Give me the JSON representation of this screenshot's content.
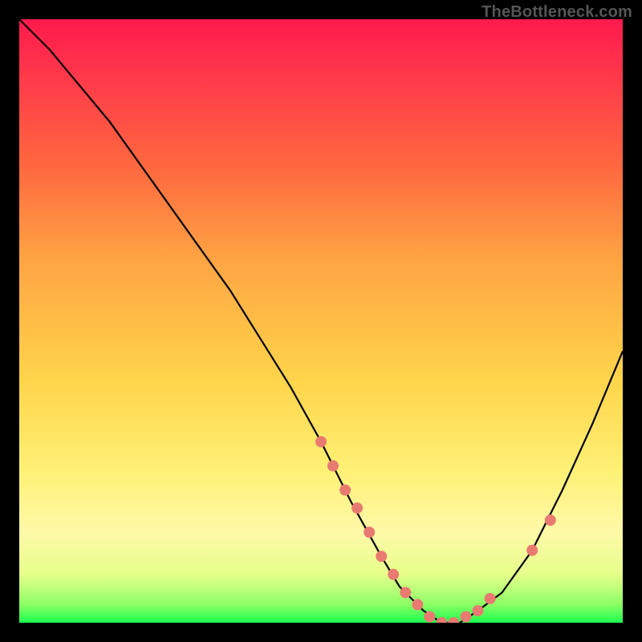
{
  "watermark": "TheBottleneck.com",
  "chart_data": {
    "type": "line",
    "title": "",
    "xlabel": "",
    "ylabel": "",
    "xlim": [
      0,
      100
    ],
    "ylim": [
      0,
      100
    ],
    "series": [
      {
        "name": "bottleneck-curve",
        "x": [
          0,
          5,
          10,
          15,
          20,
          25,
          30,
          35,
          40,
          45,
          50,
          55,
          60,
          63,
          67,
          70,
          73,
          76,
          80,
          85,
          90,
          95,
          100
        ],
        "values": [
          100,
          95,
          89,
          83,
          76,
          69,
          62,
          55,
          47,
          39,
          30,
          20,
          11,
          6,
          2,
          0,
          0,
          2,
          5,
          12,
          22,
          33,
          45
        ]
      }
    ],
    "markers": {
      "name": "highlight-points",
      "x": [
        50,
        52,
        54,
        56,
        58,
        60,
        62,
        64,
        66,
        68,
        70,
        72,
        74,
        76,
        78,
        85,
        88
      ],
      "values": [
        30,
        26,
        22,
        19,
        15,
        11,
        8,
        5,
        3,
        1,
        0,
        0,
        1,
        2,
        4,
        12,
        17
      ]
    },
    "gradient_bands": [
      {
        "pct": 0,
        "color": "#ff1a4d"
      },
      {
        "pct": 50,
        "color": "#ffd54a"
      },
      {
        "pct": 95,
        "color": "#8cff66"
      },
      {
        "pct": 100,
        "color": "#1aff4d"
      }
    ]
  }
}
